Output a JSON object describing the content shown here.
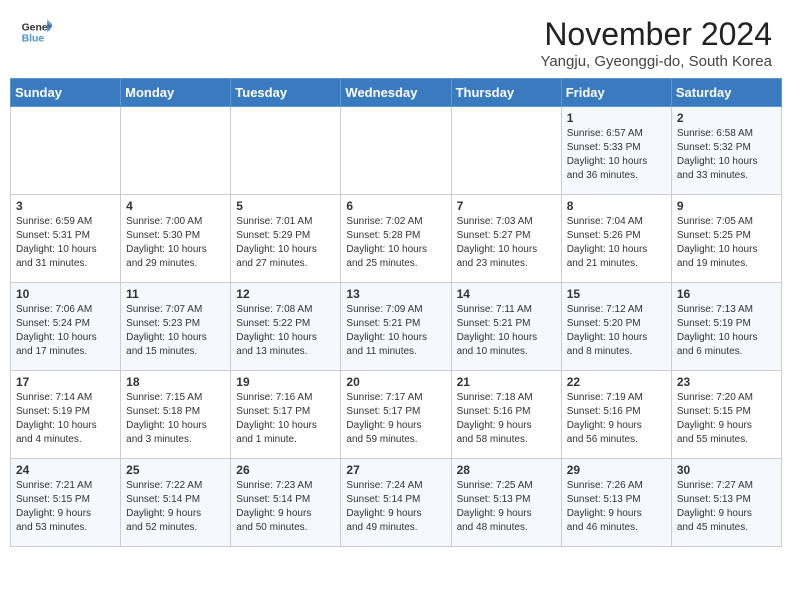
{
  "header": {
    "logo_line1": "General",
    "logo_line2": "Blue",
    "month_year": "November 2024",
    "location": "Yangju, Gyeonggi-do, South Korea"
  },
  "weekdays": [
    "Sunday",
    "Monday",
    "Tuesday",
    "Wednesday",
    "Thursday",
    "Friday",
    "Saturday"
  ],
  "weeks": [
    [
      {
        "day": "",
        "info": ""
      },
      {
        "day": "",
        "info": ""
      },
      {
        "day": "",
        "info": ""
      },
      {
        "day": "",
        "info": ""
      },
      {
        "day": "",
        "info": ""
      },
      {
        "day": "1",
        "info": "Sunrise: 6:57 AM\nSunset: 5:33 PM\nDaylight: 10 hours\nand 36 minutes."
      },
      {
        "day": "2",
        "info": "Sunrise: 6:58 AM\nSunset: 5:32 PM\nDaylight: 10 hours\nand 33 minutes."
      }
    ],
    [
      {
        "day": "3",
        "info": "Sunrise: 6:59 AM\nSunset: 5:31 PM\nDaylight: 10 hours\nand 31 minutes."
      },
      {
        "day": "4",
        "info": "Sunrise: 7:00 AM\nSunset: 5:30 PM\nDaylight: 10 hours\nand 29 minutes."
      },
      {
        "day": "5",
        "info": "Sunrise: 7:01 AM\nSunset: 5:29 PM\nDaylight: 10 hours\nand 27 minutes."
      },
      {
        "day": "6",
        "info": "Sunrise: 7:02 AM\nSunset: 5:28 PM\nDaylight: 10 hours\nand 25 minutes."
      },
      {
        "day": "7",
        "info": "Sunrise: 7:03 AM\nSunset: 5:27 PM\nDaylight: 10 hours\nand 23 minutes."
      },
      {
        "day": "8",
        "info": "Sunrise: 7:04 AM\nSunset: 5:26 PM\nDaylight: 10 hours\nand 21 minutes."
      },
      {
        "day": "9",
        "info": "Sunrise: 7:05 AM\nSunset: 5:25 PM\nDaylight: 10 hours\nand 19 minutes."
      }
    ],
    [
      {
        "day": "10",
        "info": "Sunrise: 7:06 AM\nSunset: 5:24 PM\nDaylight: 10 hours\nand 17 minutes."
      },
      {
        "day": "11",
        "info": "Sunrise: 7:07 AM\nSunset: 5:23 PM\nDaylight: 10 hours\nand 15 minutes."
      },
      {
        "day": "12",
        "info": "Sunrise: 7:08 AM\nSunset: 5:22 PM\nDaylight: 10 hours\nand 13 minutes."
      },
      {
        "day": "13",
        "info": "Sunrise: 7:09 AM\nSunset: 5:21 PM\nDaylight: 10 hours\nand 11 minutes."
      },
      {
        "day": "14",
        "info": "Sunrise: 7:11 AM\nSunset: 5:21 PM\nDaylight: 10 hours\nand 10 minutes."
      },
      {
        "day": "15",
        "info": "Sunrise: 7:12 AM\nSunset: 5:20 PM\nDaylight: 10 hours\nand 8 minutes."
      },
      {
        "day": "16",
        "info": "Sunrise: 7:13 AM\nSunset: 5:19 PM\nDaylight: 10 hours\nand 6 minutes."
      }
    ],
    [
      {
        "day": "17",
        "info": "Sunrise: 7:14 AM\nSunset: 5:19 PM\nDaylight: 10 hours\nand 4 minutes."
      },
      {
        "day": "18",
        "info": "Sunrise: 7:15 AM\nSunset: 5:18 PM\nDaylight: 10 hours\nand 3 minutes."
      },
      {
        "day": "19",
        "info": "Sunrise: 7:16 AM\nSunset: 5:17 PM\nDaylight: 10 hours\nand 1 minute."
      },
      {
        "day": "20",
        "info": "Sunrise: 7:17 AM\nSunset: 5:17 PM\nDaylight: 9 hours\nand 59 minutes."
      },
      {
        "day": "21",
        "info": "Sunrise: 7:18 AM\nSunset: 5:16 PM\nDaylight: 9 hours\nand 58 minutes."
      },
      {
        "day": "22",
        "info": "Sunrise: 7:19 AM\nSunset: 5:16 PM\nDaylight: 9 hours\nand 56 minutes."
      },
      {
        "day": "23",
        "info": "Sunrise: 7:20 AM\nSunset: 5:15 PM\nDaylight: 9 hours\nand 55 minutes."
      }
    ],
    [
      {
        "day": "24",
        "info": "Sunrise: 7:21 AM\nSunset: 5:15 PM\nDaylight: 9 hours\nand 53 minutes."
      },
      {
        "day": "25",
        "info": "Sunrise: 7:22 AM\nSunset: 5:14 PM\nDaylight: 9 hours\nand 52 minutes."
      },
      {
        "day": "26",
        "info": "Sunrise: 7:23 AM\nSunset: 5:14 PM\nDaylight: 9 hours\nand 50 minutes."
      },
      {
        "day": "27",
        "info": "Sunrise: 7:24 AM\nSunset: 5:14 PM\nDaylight: 9 hours\nand 49 minutes."
      },
      {
        "day": "28",
        "info": "Sunrise: 7:25 AM\nSunset: 5:13 PM\nDaylight: 9 hours\nand 48 minutes."
      },
      {
        "day": "29",
        "info": "Sunrise: 7:26 AM\nSunset: 5:13 PM\nDaylight: 9 hours\nand 46 minutes."
      },
      {
        "day": "30",
        "info": "Sunrise: 7:27 AM\nSunset: 5:13 PM\nDaylight: 9 hours\nand 45 minutes."
      }
    ]
  ]
}
